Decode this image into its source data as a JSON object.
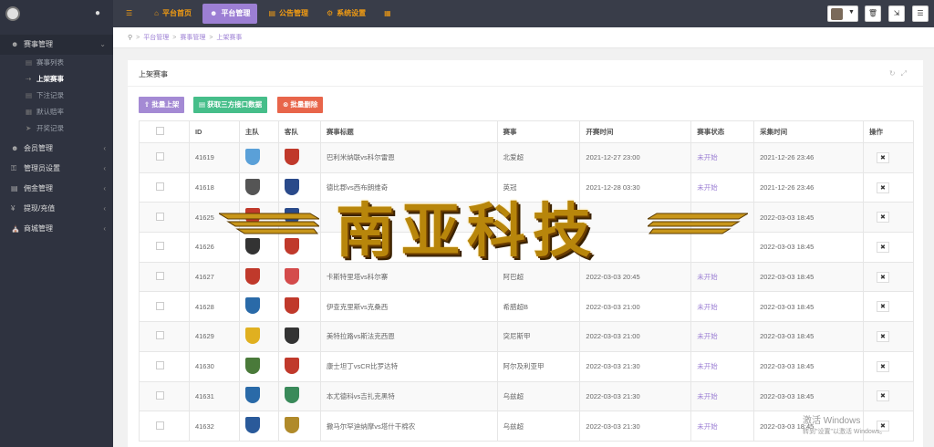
{
  "topnav": {
    "items": [
      {
        "icon": "menu-icon",
        "label": ""
      },
      {
        "icon": "home-icon",
        "label": "平台首页"
      },
      {
        "icon": "user-icon",
        "label": "平台管理",
        "active": true
      },
      {
        "icon": "list-icon",
        "label": "公告管理"
      },
      {
        "icon": "gear-icon",
        "label": "系统设置"
      },
      {
        "icon": "grid-icon",
        "label": ""
      }
    ]
  },
  "sidebar": {
    "items": [
      {
        "label": "赛事管理",
        "icon": "group-icon"
      },
      {
        "label": "会员管理",
        "icon": "user-icon"
      },
      {
        "label": "管理员设置",
        "icon": "key-icon"
      },
      {
        "label": "佣金管理",
        "icon": "wallet-icon"
      },
      {
        "label": "提现/充值",
        "icon": "yen-icon"
      },
      {
        "label": "商城管理",
        "icon": "bank-icon"
      }
    ],
    "subitems": [
      {
        "label": "赛事列表",
        "active": false
      },
      {
        "label": "上架赛事",
        "active": true
      },
      {
        "label": "下注记录",
        "active": false
      },
      {
        "label": "默认赔率",
        "active": false
      },
      {
        "label": "开奖记录",
        "active": false
      }
    ]
  },
  "breadcrumb": {
    "items": [
      "平台管理",
      "赛事管理",
      "上架赛事"
    ]
  },
  "panel": {
    "title": "上架赛事",
    "buttons": {
      "batch_list": "批量上架",
      "fetch_api": "获取三方接口数据",
      "batch_delete": "批量删除"
    }
  },
  "table": {
    "headers": [
      "",
      "ID",
      "主队",
      "客队",
      "赛事标题",
      "赛事",
      "开赛时间",
      "赛事状态",
      "采集时间",
      "操作"
    ],
    "rows": [
      {
        "id": "41619",
        "home_color": "#5aa0d8",
        "away_color": "#c0392b",
        "title": "巴利米纳联vs科尔雷恩",
        "league": "北爱超",
        "start": "2021-12-27 23:00",
        "status": "未开始",
        "collected": "2021-12-26 23:46"
      },
      {
        "id": "41618",
        "home_color": "#555555",
        "away_color": "#2a4a8a",
        "title": "德比郡vs西布朗维奇",
        "league": "英冠",
        "start": "2021-12-28 03:30",
        "status": "未开始",
        "collected": "2021-12-26 23:46"
      },
      {
        "id": "41625",
        "home_color": "#c0392b",
        "away_color": "#2a4a8a",
        "title": "",
        "league": "",
        "start": "",
        "status": "",
        "collected": "2022-03-03 18:45"
      },
      {
        "id": "41626",
        "home_color": "#333333",
        "away_color": "#c0392b",
        "title": "",
        "league": "",
        "start": "",
        "status": "",
        "collected": "2022-03-03 18:45"
      },
      {
        "id": "41627",
        "home_color": "#c0392b",
        "away_color": "#d44b4b",
        "title": "卡斯特里塔vs科尔寨",
        "league": "阿巴超",
        "start": "2022-03-03 20:45",
        "status": "未开始",
        "collected": "2022-03-03 18:45"
      },
      {
        "id": "41628",
        "home_color": "#2a6aa8",
        "away_color": "#c0392b",
        "title": "伊查克里斯vs克桑西",
        "league": "希腊超B",
        "start": "2022-03-03 21:00",
        "status": "未开始",
        "collected": "2022-03-03 18:45"
      },
      {
        "id": "41629",
        "home_color": "#e0b020",
        "away_color": "#333333",
        "title": "美特拉路vs斯法克西恩",
        "league": "突尼斯甲",
        "start": "2022-03-03 21:00",
        "status": "未开始",
        "collected": "2022-03-03 18:45"
      },
      {
        "id": "41630",
        "home_color": "#4a7a3a",
        "away_color": "#c0392b",
        "title": "康士坦丁vsCR比罗达特",
        "league": "阿尔及利亚甲",
        "start": "2022-03-03 21:30",
        "status": "未开始",
        "collected": "2022-03-03 18:45"
      },
      {
        "id": "41631",
        "home_color": "#2a6aa8",
        "away_color": "#3a8a5a",
        "title": "本尤德科vs吉扎克黑特",
        "league": "乌兹超",
        "start": "2022-03-03 21:30",
        "status": "未开始",
        "collected": "2022-03-03 18:45"
      },
      {
        "id": "41632",
        "home_color": "#2a5a9a",
        "away_color": "#b08a2a",
        "title": "撒马尔罕迪纳摩vs塔什干棉农",
        "league": "乌兹超",
        "start": "2022-03-03 21:30",
        "status": "未开始",
        "collected": "2022-03-03 18:45"
      }
    ]
  },
  "watermark": {
    "text": "南亚科技"
  },
  "windows_notice": {
    "title": "激活 Windows",
    "sub": "转到\"设置\"以激活 Windows。"
  }
}
